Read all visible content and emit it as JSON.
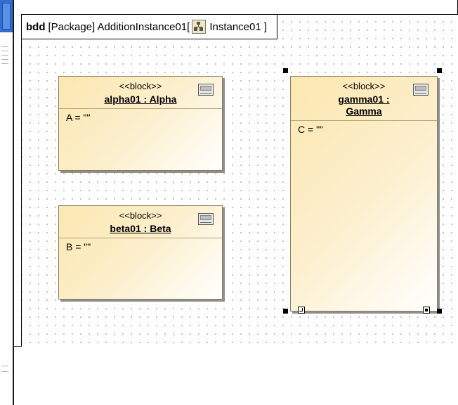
{
  "diagram": {
    "kind": "bdd",
    "header_text": "[Package] AdditionInstance01[",
    "instance_name": "Instance01 ]",
    "instance_icon": "instance-diagram-icon"
  },
  "blocks": [
    {
      "id": "alpha01",
      "stereotype": "<<block>>",
      "name": "alpha01 : Alpha",
      "attribute": "A = \"\"",
      "icon": "component-icon"
    },
    {
      "id": "beta01",
      "stereotype": "<<block>>",
      "name": "beta01 : Beta",
      "attribute": "B = \"\"",
      "icon": "component-icon"
    },
    {
      "id": "gamma01",
      "stereotype": "<<block>>",
      "name_line1": "gamma01 :",
      "name_line2": "Gamma",
      "attribute": "C = \"\"",
      "icon": "component-icon",
      "selected": true
    }
  ],
  "colors": {
    "block_fill": "#fbe7b0",
    "block_border": "#8c7c5a",
    "selection_accent": "#2f6fd1"
  }
}
